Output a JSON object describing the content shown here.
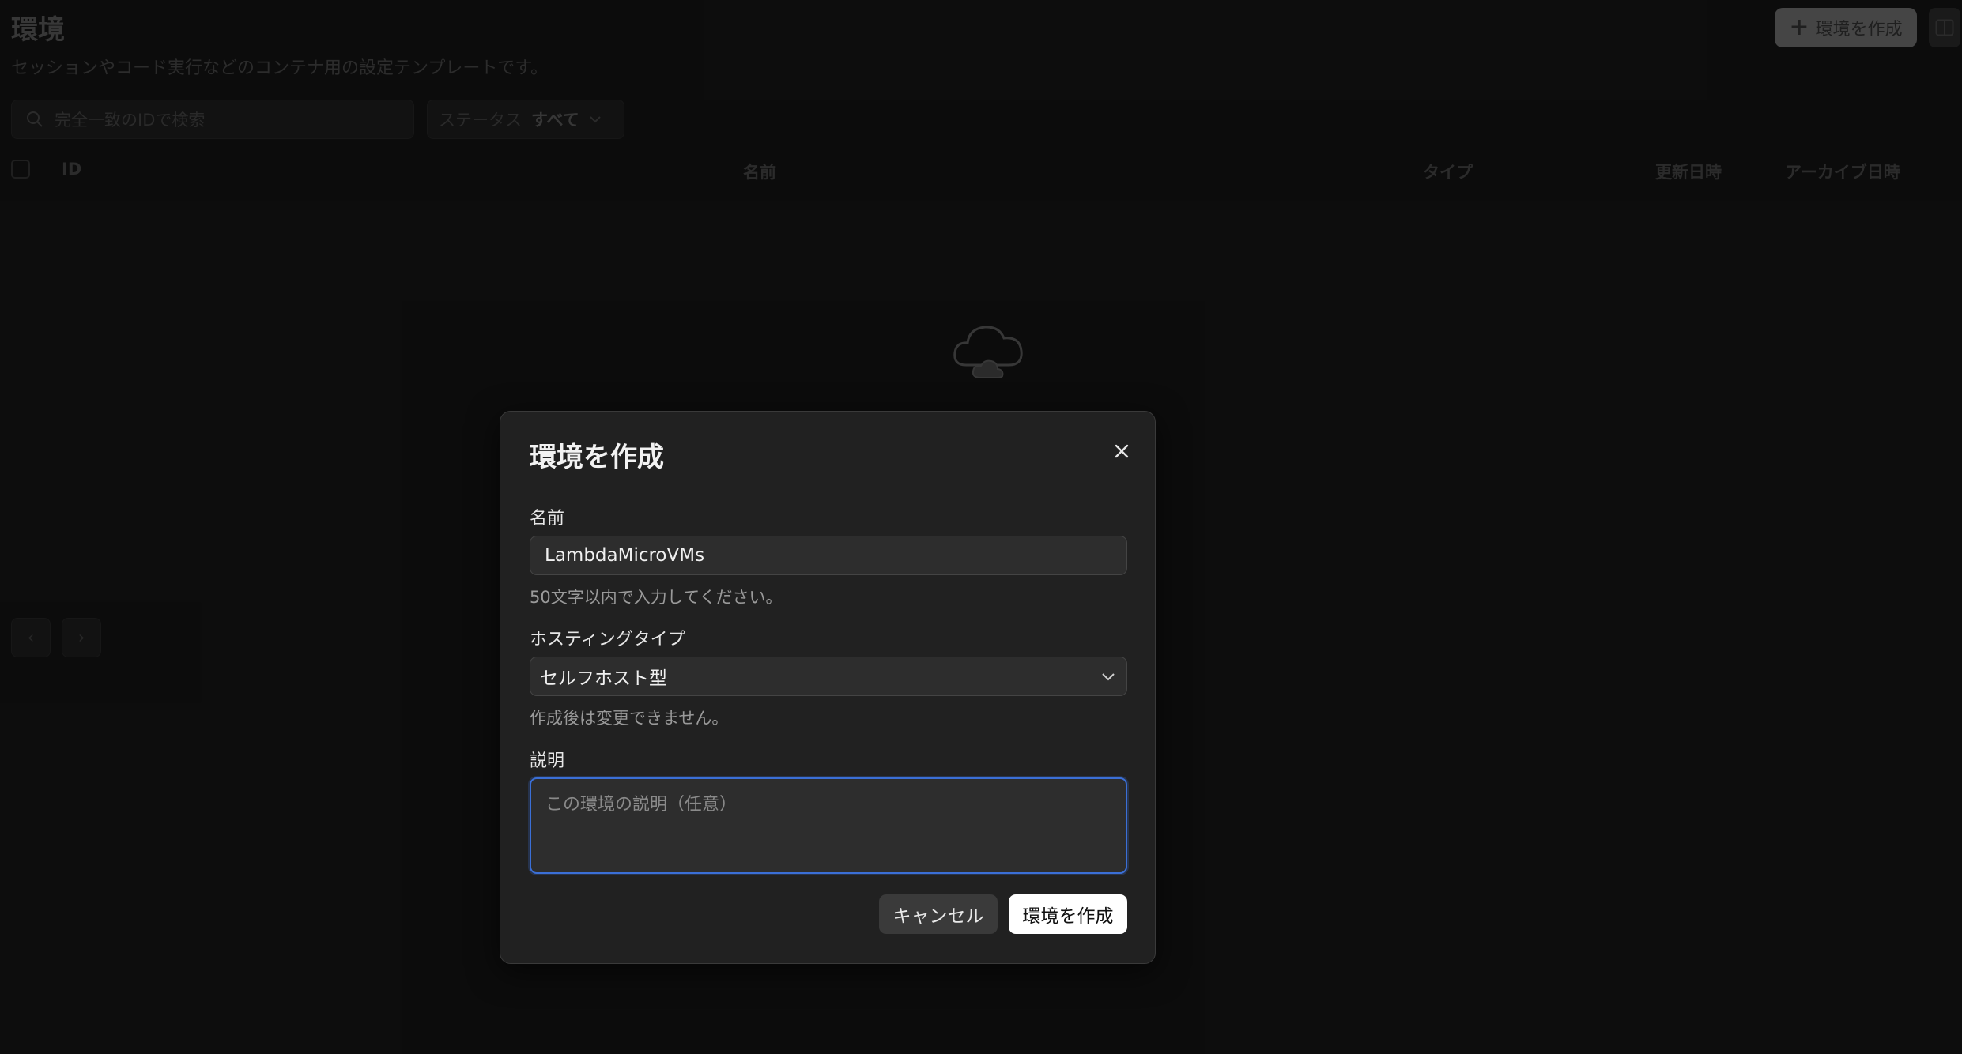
{
  "background": {
    "page_title": "環境",
    "page_subtitle": "セッションやコード実行などのコンテナ用の設定テンプレートです。",
    "create_button_label": "環境を作成",
    "search_placeholder": "完全一致のIDで検索",
    "status_filter": {
      "label": "ステータス",
      "value": "すべて"
    },
    "table_columns": [
      "ID",
      "名前",
      "タイプ",
      "更新日時",
      "アーカイブ日時"
    ]
  },
  "modal": {
    "title": "環境を作成",
    "name_field": {
      "label": "名前",
      "value": "LambdaMicroVMs",
      "help": "50文字以内で入力してください。"
    },
    "hosting_field": {
      "label": "ホスティングタイプ",
      "selected": "セルフホスト型",
      "help": "作成後は変更できません。"
    },
    "description_field": {
      "label": "説明",
      "placeholder": "この環境の説明（任意）",
      "value": ""
    },
    "cancel_label": "キャンセル",
    "submit_label": "環境を作成"
  },
  "colors": {
    "modal_bg": "#212121",
    "focus_ring": "#3b6fd6",
    "primary_button_bg": "#ffffff",
    "secondary_button_bg": "#3a3a3a"
  }
}
